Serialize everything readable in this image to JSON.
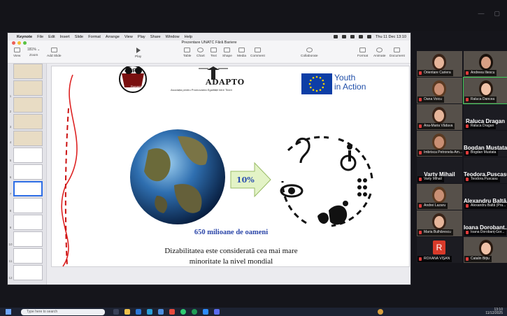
{
  "mac": {
    "menu": [
      "Keynote",
      "File",
      "Edit",
      "Insert",
      "Slide",
      "Format",
      "Arrange",
      "View",
      "Play",
      "Share",
      "Window",
      "Help"
    ],
    "clock": "Thu 11 Dec  13:10"
  },
  "keynote": {
    "doc_title": "Prezentare UNATC Fără Bariere",
    "toolbar": {
      "view": "View",
      "zoom_value": "181% ⌄",
      "zoom": "Zoom",
      "add_slide": "Add Slide",
      "play": "Play",
      "table": "Table",
      "chart": "Chart",
      "text": "Text",
      "shape": "Shape",
      "media": "Media",
      "comment": "Comment",
      "collaborate": "Collaborate",
      "format": "Format",
      "animate": "Animate",
      "document": "Document"
    },
    "navigator_numbers": [
      "1",
      "2",
      "3",
      "4",
      "5",
      "6",
      "7",
      "8",
      "9",
      "10",
      "11",
      "12"
    ]
  },
  "slide": {
    "logo_left": "YORK",
    "logo_left_sub": "Romania",
    "adapto_title": "ADAPTO",
    "adapto_sub": "Asociația pentru Promovarea Egalității între Tineri",
    "youth_line1": "Youth",
    "youth_line2": "in Action",
    "percent": "10%",
    "headline": "650 milioane de oameni",
    "body_line1": "Dizabilitatea este considerată cea mai mare",
    "body_line2": "minoritate la nivel mondial"
  },
  "zoom": {
    "participants": [
      {
        "name": "Orientare Cariera"
      },
      {
        "name": "Andreea Iliescu"
      },
      {
        "name": "Oana Voicu"
      },
      {
        "name": "Raluca Dancea"
      },
      {
        "name": "Ana-Maria Văduva"
      },
      {
        "name": "Raluca Dragan",
        "big": "Raluca Dragan"
      },
      {
        "name": "Imbrisca Petronela-Am..."
      },
      {
        "name": "Bogdan Mustata",
        "big": "Bogdan Mustata"
      },
      {
        "name": "Varty Mihail",
        "big": "Varty Mihail"
      },
      {
        "name": "Teodora.Puscasu",
        "big": "Teodora.Puscasu"
      },
      {
        "name": "Andrei Lazaru"
      },
      {
        "name": "Alexandru Baltă (Pra...",
        "big": "Alexandru  Baltă..."
      },
      {
        "name": "Maria Bulhărescu"
      },
      {
        "name": "Ioana Dorobanț-Gor...",
        "big": "Ioana  Dorobant..."
      },
      {
        "name": "ROXANA VIȘAN",
        "avatar": "R"
      },
      {
        "name": "Catalin Bițtu"
      }
    ]
  },
  "taskbar": {
    "search_placeholder": "Type here to search",
    "time": "13:10",
    "date": "11/12/2025"
  }
}
